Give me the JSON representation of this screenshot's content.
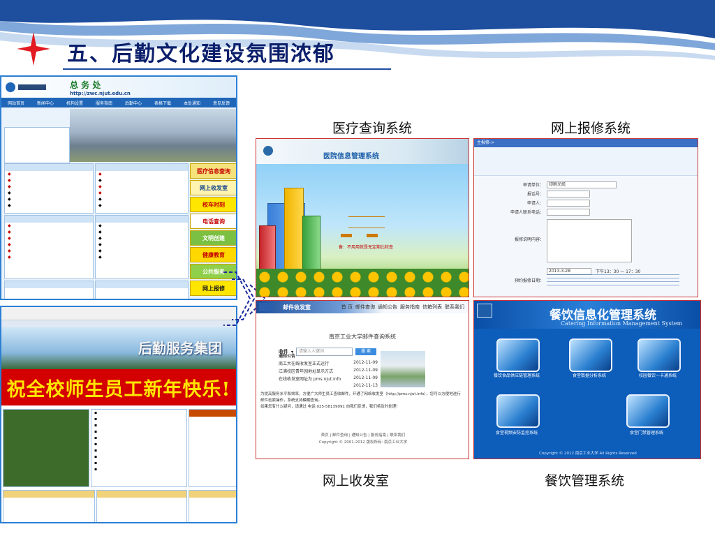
{
  "slide": {
    "title": "五、后勤文化建设氛围浓郁",
    "captions": {
      "medical": "医疗查询系统",
      "repair": "网上报修系统",
      "mail": "网上收发室",
      "catering": "餐饮管理系统"
    }
  },
  "portal": {
    "dept": "总 务 处",
    "url": "http://zwc.njut.edu.cn",
    "nav": [
      "网站首页",
      "新闻中心",
      "机构设置",
      "服务指南",
      "后勤中心",
      "表格下载",
      "本处通知",
      "意见反馈"
    ],
    "side_buttons": [
      "医疗信息查询",
      "网上收发室",
      "校车时刻",
      "电话查询",
      "文明创建",
      "健康教育",
      "公共服务",
      "网上报修"
    ]
  },
  "logistics": {
    "group": "后勤服务集团",
    "banner": "祝全校师生员工新年快乐!"
  },
  "medical": {
    "system_title": "医院信息管理系统",
    "footer": "备：不用用就是无定期比较查"
  },
  "repair": {
    "header": "主报修->",
    "fields": [
      "申请单位：",
      "报话号：",
      "申请人：",
      "申请人联系电话："
    ],
    "unit_value": "印刷光缆",
    "content_label": "报修说明内容：",
    "date_value": "2013-3-28",
    "time_label": "下午13：30 — 17：30",
    "desc_label": "预约报修日期："
  },
  "mail": {
    "brand": "邮件收发室",
    "menu": [
      "首 页",
      "邮件查询",
      "通知公告",
      "服务指南",
      "信箱列表",
      "联系我们"
    ],
    "system": "南京工业大学邮件查询系统",
    "search_label": "收件",
    "search_placeholder": "请输入人键词",
    "search_button": "搜 索",
    "notice_head": "通知公告",
    "notices": [
      {
        "text": "南工大在线收发室正式运行",
        "date": "2012-11-09"
      },
      {
        "text": "江浦校区青年园地址显示方式",
        "date": "2012-11-09"
      },
      {
        "text": "在线收发室网址为 pms.njut.info",
        "date": "2012-11-09"
      },
      {
        "text": "",
        "date": "2012-11-13"
      }
    ],
    "body_lines": [
      "为提高服务水平和效率，方便广大师生员工查收邮件，开通了网络收发室（http://pms.njut.info），您可以方便地进行邮件检索操作，系统支持模糊查询。",
      "如果您有什么疑问，请通过 电话 025-58139091 向我们反馈，我们将及时处理！"
    ],
    "footer_links": "首页 | 邮件查询 | 通知公告 | 服务指南 | 联系我们",
    "copyright": "Copyright © 2001-2012 版权所有: 南京工业大学"
  },
  "catering": {
    "title_cn": "餐饮信息化管理系统",
    "title_en": "Catering Information Management System",
    "modules": [
      "餐饮食品供应链管理系统",
      "食堂数据分析系统",
      "校园餐饮一卡通系统",
      "食堂视频安防监控系统",
      "食堂门禁管理系统"
    ],
    "copyright": "Copyright © 2012  南京工业大学 All Rights Reserved"
  },
  "colors": {
    "title": "#0b1f6b",
    "frame_border": "#c33333",
    "portal_blue": "#1f66b8",
    "banner_red": "#d40000",
    "catering_blue": "#0d5dbb"
  }
}
